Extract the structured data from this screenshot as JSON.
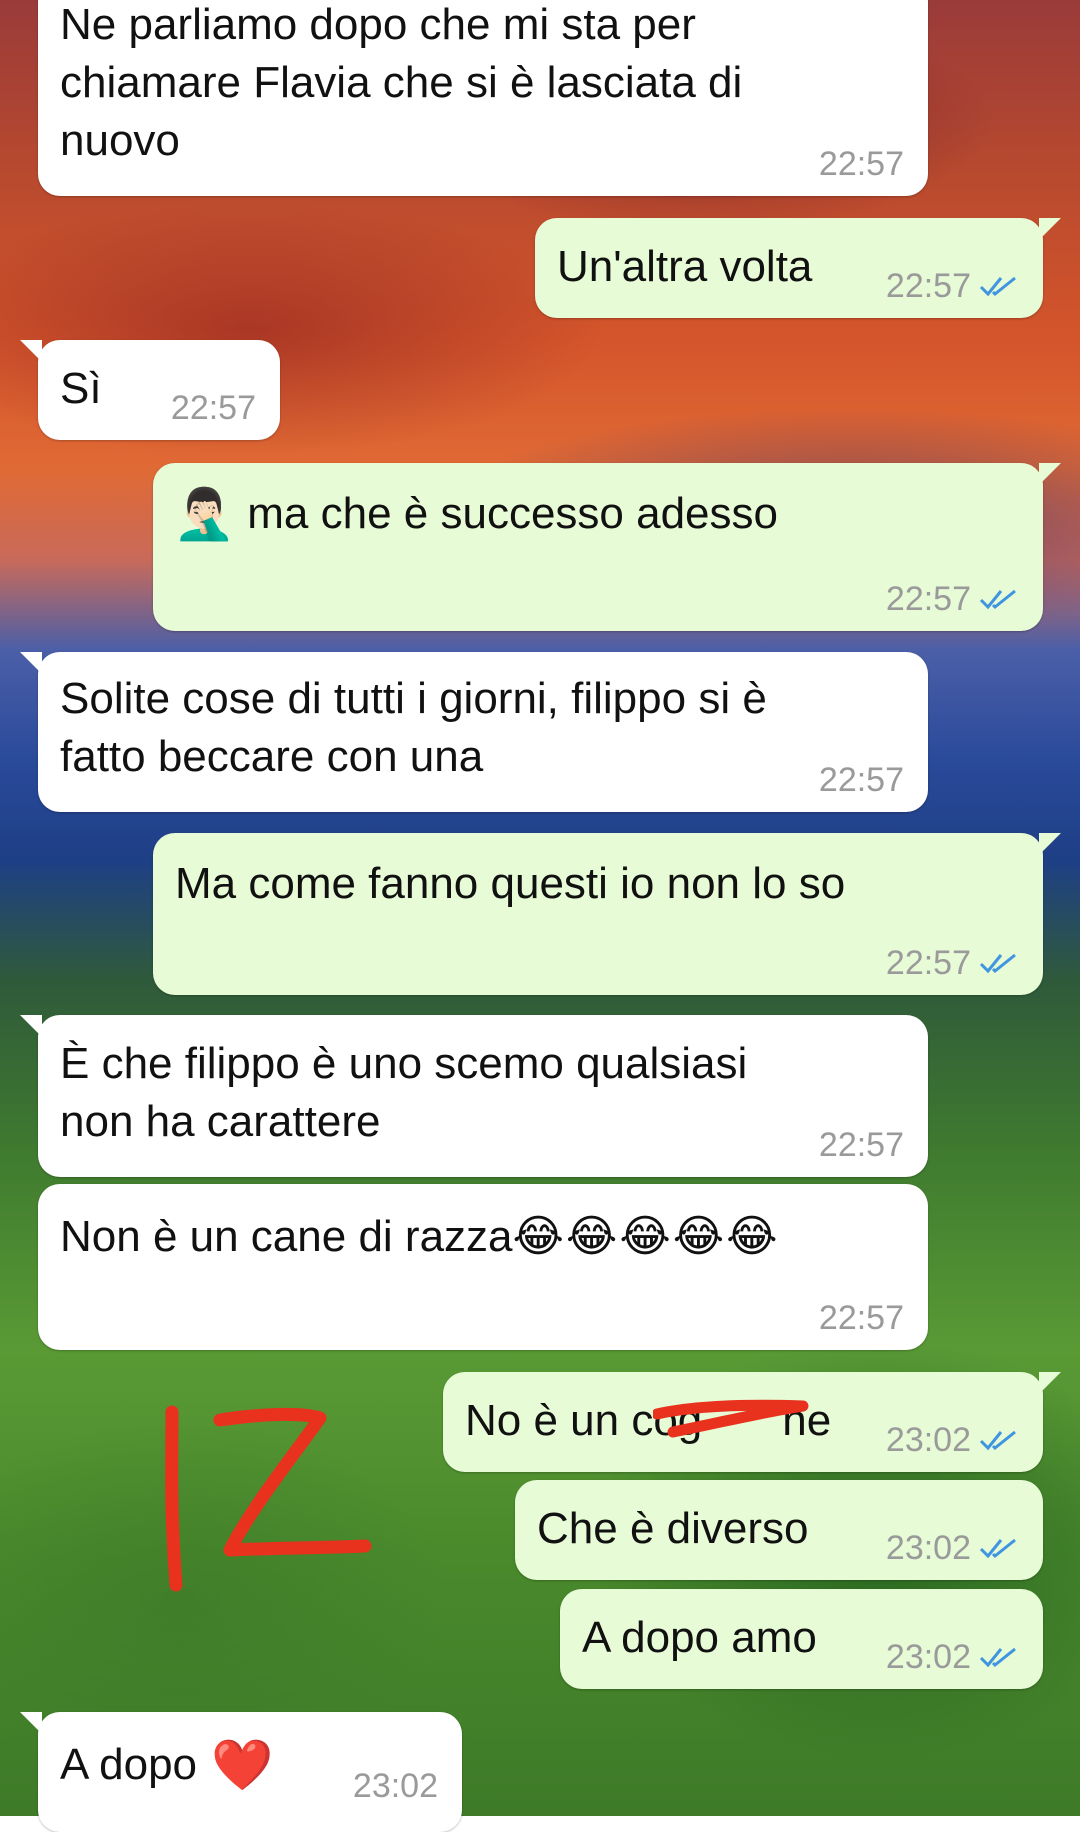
{
  "messages": [
    {
      "direction": "in",
      "text": "Ne parliamo dopo che mi sta per\nchiamare Flavia che si è lasciata di\nnuovo",
      "time": "22:57"
    },
    {
      "direction": "out",
      "text": "Un'altra volta",
      "time": "22:57",
      "status": "read-double-check-icon"
    },
    {
      "direction": "in",
      "text": "Sì",
      "time": "22:57"
    },
    {
      "direction": "out",
      "emoji": "🤦🏻‍♂️",
      "text": "ma che è successo adesso",
      "time": "22:57",
      "status": "read-double-check-icon"
    },
    {
      "direction": "in",
      "text": "Solite cose di tutti i giorni, filippo si è\nfatto beccare con una",
      "time": "22:57"
    },
    {
      "direction": "out",
      "text": "Ma come fanno questi io non lo so",
      "time": "22:57",
      "status": "read-double-check-icon"
    },
    {
      "direction": "in",
      "text": "È che filippo è uno scemo qualsiasi\nnon ha carattere",
      "time": "22:57"
    },
    {
      "direction": "in",
      "text": "Non è un cane di razza",
      "emoji": "😂😂😂😂😂",
      "time": "22:57"
    },
    {
      "direction": "out",
      "text": "No è un cog",
      "text_after": "ne",
      "time": "23:02",
      "status": "read-double-check-icon"
    },
    {
      "direction": "out",
      "text": "Che è diverso",
      "time": "23:02",
      "status": "read-double-check-icon"
    },
    {
      "direction": "out",
      "text": "A dopo amo",
      "time": "23:02",
      "status": "read-double-check-icon"
    },
    {
      "direction": "in",
      "text": "A dopo",
      "emoji": "❤️",
      "time": "23:02"
    }
  ],
  "overlay": {
    "scribble_color": "#e8321e",
    "handwritten_mark": "IZ"
  },
  "colors": {
    "incoming_bubble": "#ffffff",
    "outgoing_bubble": "#e7fbd6",
    "read_tick": "#3f95e0",
    "timestamp": "#9a9a9a"
  }
}
